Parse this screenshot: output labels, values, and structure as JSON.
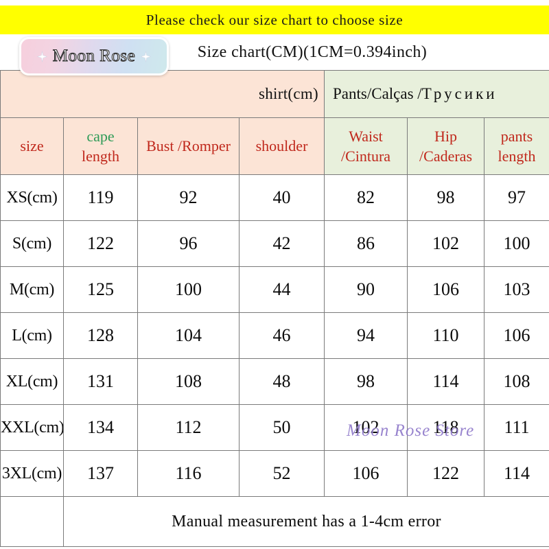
{
  "banner": {
    "text": "Please check our size chart to choose size",
    "background": "#ffff00"
  },
  "title": {
    "text": "Size chart(CM)(1CM=0.394inch)"
  },
  "logo": {
    "text": "Moon Rose"
  },
  "watermark": {
    "text": "Moon Rose Store",
    "color": "#8a74c8"
  },
  "footer": {
    "note": "Manual measurement has a 1-4cm error"
  },
  "colors": {
    "shirt_group_bg": "#fce4d6",
    "pants_group_bg": "#e8f0dc",
    "header_text_red": "#c0281c",
    "cape_text_green": "#2e9b57"
  },
  "groups": {
    "shirt": "shirt(cm)",
    "pants_latin": "Pants/Calças /",
    "pants_russian": "Трусики"
  },
  "chart_data": {
    "type": "table",
    "title": "Size chart(CM)(1CM=0.394inch)",
    "columns": [
      "size",
      "cape length",
      "Bust /Romper",
      "shoulder",
      "Waist /Cintura",
      "Hip /Caderas",
      "pants length"
    ],
    "column_parts": [
      {
        "line1": "size",
        "line2": ""
      },
      {
        "line1": "cape",
        "line2": "length"
      },
      {
        "line1": "Bust /Romper",
        "line2": ""
      },
      {
        "line1": "shoulder",
        "line2": ""
      },
      {
        "line1": "Waist",
        "line2": "/Cintura"
      },
      {
        "line1": "Hip",
        "line2": "/Caderas"
      },
      {
        "line1": "pants",
        "line2": "length"
      }
    ],
    "rows": [
      {
        "size": "XS(cm)",
        "cape_length": "119",
        "bust_romper": "92",
        "shoulder": "40",
        "waist_cintura": "82",
        "hip_caderas": "98",
        "pants_length": "97"
      },
      {
        "size": "S(cm)",
        "cape_length": "122",
        "bust_romper": "96",
        "shoulder": "42",
        "waist_cintura": "86",
        "hip_caderas": "102",
        "pants_length": "100"
      },
      {
        "size": "M(cm)",
        "cape_length": "125",
        "bust_romper": "100",
        "shoulder": "44",
        "waist_cintura": "90",
        "hip_caderas": "106",
        "pants_length": "103"
      },
      {
        "size": "L(cm)",
        "cape_length": "128",
        "bust_romper": "104",
        "shoulder": "46",
        "waist_cintura": "94",
        "hip_caderas": "110",
        "pants_length": "106"
      },
      {
        "size": "XL(cm)",
        "cape_length": "131",
        "bust_romper": "108",
        "shoulder": "48",
        "waist_cintura": "98",
        "hip_caderas": "114",
        "pants_length": "108"
      },
      {
        "size": "XXL(cm)",
        "cape_length": "134",
        "bust_romper": "112",
        "shoulder": "50",
        "waist_cintura": "102",
        "hip_caderas": "118",
        "pants_length": "111"
      },
      {
        "size": "3XL(cm)",
        "cape_length": "137",
        "bust_romper": "116",
        "shoulder": "52",
        "waist_cintura": "106",
        "hip_caderas": "122",
        "pants_length": "114"
      }
    ],
    "units": "cm",
    "note": "Manual measurement has a 1-4cm error"
  }
}
